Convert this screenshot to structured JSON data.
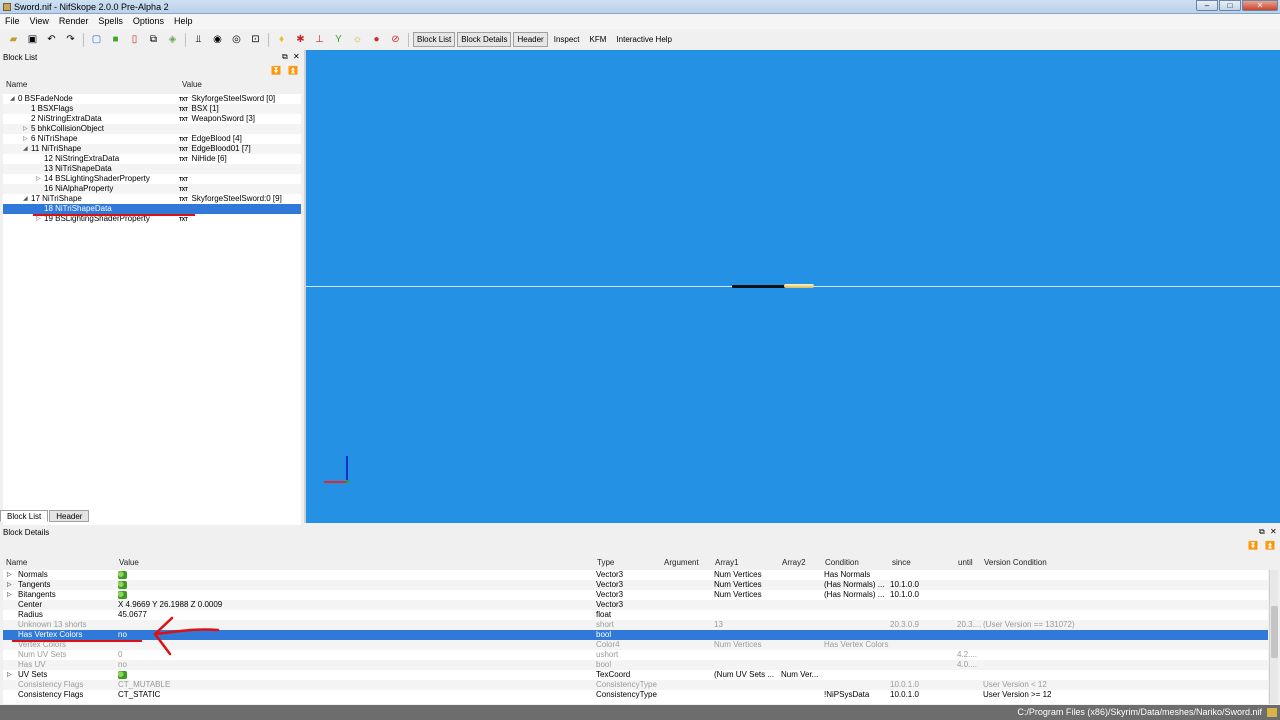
{
  "window": {
    "title": "Sword.nif - NifSkope 2.0.0 Pre-Alpha 2",
    "minimize": "–",
    "maximize": "□",
    "close": "✕"
  },
  "menu": [
    "File",
    "View",
    "Render",
    "Spells",
    "Options",
    "Help"
  ],
  "toolbar": {
    "text_buttons": [
      "Block List",
      "Block Details",
      "Header",
      "Inspect",
      "KFM",
      "Interactive Help"
    ]
  },
  "block_list": {
    "title": "Block List",
    "columns": {
      "name": "Name",
      "value": "Value"
    },
    "tabs": [
      "Block List",
      "Header"
    ],
    "rows": [
      {
        "name": "0 BSFadeNode",
        "value": "SkyforgeSteelSword [0]",
        "depth": 0,
        "expander": "◢",
        "txt": true
      },
      {
        "name": "1 BSXFlags",
        "value": "BSX [1]",
        "depth": 1,
        "expander": "",
        "txt": true
      },
      {
        "name": "2 NiStringExtraData",
        "value": "WeaponSword [3]",
        "depth": 1,
        "expander": "",
        "txt": true
      },
      {
        "name": "5 bhkCollisionObject",
        "value": "",
        "depth": 1,
        "expander": "▷",
        "txt": false
      },
      {
        "name": "6 NiTriShape",
        "value": "EdgeBlood [4]",
        "depth": 1,
        "expander": "▷",
        "txt": true
      },
      {
        "name": "11 NiTriShape",
        "value": "EdgeBlood01 [7]",
        "depth": 1,
        "expander": "◢",
        "txt": true
      },
      {
        "name": "12 NiStringExtraData",
        "value": "NiHide [6]",
        "depth": 2,
        "expander": "",
        "txt": true
      },
      {
        "name": "13 NiTriShapeData",
        "value": "",
        "depth": 2,
        "expander": "",
        "txt": false
      },
      {
        "name": "14 BSLightingShaderProperty",
        "value": "",
        "depth": 2,
        "expander": "▷",
        "txt": true
      },
      {
        "name": "16 NiAlphaProperty",
        "value": "",
        "depth": 2,
        "expander": "",
        "txt": true
      },
      {
        "name": "17 NiTriShape",
        "value": "SkyforgeSteelSword:0 [9]",
        "depth": 1,
        "expander": "◢",
        "txt": true
      },
      {
        "name": "18 NiTriShapeData",
        "value": "",
        "depth": 2,
        "expander": "",
        "txt": false,
        "selected": true
      },
      {
        "name": "19 BSLightingShaderProperty",
        "value": "",
        "depth": 2,
        "expander": "▷",
        "txt": true
      }
    ]
  },
  "block_details": {
    "title": "Block Details",
    "columns": [
      "Name",
      "Value",
      "Type",
      "Argument",
      "Array1",
      "Array2",
      "Condition",
      "since",
      "until",
      "Version Condition"
    ],
    "rows": [
      {
        "expander": "▷",
        "name": "Normals",
        "value": "",
        "icon": true,
        "type": "Vector3",
        "argument": "",
        "array1": "Num Vertices",
        "array2": "",
        "condition": "Has Normals",
        "since": "",
        "until": "",
        "vcond": "",
        "grey": false
      },
      {
        "expander": "▷",
        "name": "Tangents",
        "value": "",
        "icon": true,
        "type": "Vector3",
        "argument": "",
        "array1": "Num Vertices",
        "array2": "",
        "condition": "(Has Normals) ...",
        "since": "10.1.0.0",
        "until": "",
        "vcond": "",
        "grey": false
      },
      {
        "expander": "▷",
        "name": "Bitangents",
        "value": "",
        "icon": true,
        "type": "Vector3",
        "argument": "",
        "array1": "Num Vertices",
        "array2": "",
        "condition": "(Has Normals) ...",
        "since": "10.1.0.0",
        "until": "",
        "vcond": "",
        "grey": false
      },
      {
        "expander": "",
        "name": "Center",
        "value": "X 4.9669 Y 26.1988 Z 0.0009",
        "icon": false,
        "type": "Vector3",
        "argument": "",
        "array1": "",
        "array2": "",
        "condition": "",
        "since": "",
        "until": "",
        "vcond": "",
        "grey": false
      },
      {
        "expander": "",
        "name": "Radius",
        "value": "45.0677",
        "icon": false,
        "type": "float",
        "argument": "",
        "array1": "",
        "array2": "",
        "condition": "",
        "since": "",
        "until": "",
        "vcond": "",
        "grey": false
      },
      {
        "expander": "",
        "name": "Unknown 13 shorts",
        "value": "",
        "icon": false,
        "type": "short",
        "argument": "",
        "array1": "13",
        "array2": "",
        "condition": "",
        "since": "20.3.0.9",
        "until": "20.3....",
        "vcond": "(User Version == 131072)",
        "grey": true
      },
      {
        "expander": "",
        "name": "Has Vertex Colors",
        "value": "no",
        "icon": false,
        "type": "bool",
        "argument": "",
        "array1": "",
        "array2": "",
        "condition": "",
        "since": "",
        "until": "",
        "vcond": "",
        "grey": false,
        "selected": true
      },
      {
        "expander": "",
        "name": "Vertex Colors",
        "value": "",
        "icon": false,
        "type": "Color4",
        "argument": "",
        "array1": "Num Vertices",
        "array2": "",
        "condition": "Has Vertex Colors",
        "since": "",
        "until": "",
        "vcond": "",
        "grey": true
      },
      {
        "expander": "",
        "name": "Num UV Sets",
        "value": "0",
        "icon": false,
        "type": "ushort",
        "argument": "",
        "array1": "",
        "array2": "",
        "condition": "",
        "since": "",
        "until": "4.2....",
        "vcond": "",
        "grey": true
      },
      {
        "expander": "",
        "name": "Has UV",
        "value": "no",
        "icon": false,
        "type": "bool",
        "argument": "",
        "array1": "",
        "array2": "",
        "condition": "",
        "since": "",
        "until": "4.0....",
        "vcond": "",
        "grey": true
      },
      {
        "expander": "▷",
        "name": "UV Sets",
        "value": "",
        "icon": true,
        "type": "TexCoord",
        "argument": "",
        "array1": "(Num UV Sets ...",
        "array2": "Num Ver...",
        "condition": "",
        "since": "",
        "until": "",
        "vcond": "",
        "grey": false
      },
      {
        "expander": "",
        "name": "Consistency Flags",
        "value": "CT_MUTABLE",
        "icon": false,
        "type": "ConsistencyType",
        "argument": "",
        "array1": "",
        "array2": "",
        "condition": "",
        "since": "10.0.1.0",
        "until": "",
        "vcond": "User Version < 12",
        "grey": true
      },
      {
        "expander": "",
        "name": "Consistency Flags",
        "value": "CT_STATIC",
        "icon": false,
        "type": "ConsistencyType",
        "argument": "",
        "array1": "",
        "array2": "",
        "condition": "!NiPSysData",
        "since": "10.0.1.0",
        "until": "",
        "vcond": "User Version >= 12",
        "grey": false
      }
    ]
  },
  "status": {
    "path": "C:/Program Files (x86)/Skyrim/Data/meshes/Nariko/Sword.nif"
  },
  "colors": {
    "viewport": "#2591e5",
    "selection": "#3079d8",
    "annotation": "#e01010"
  }
}
